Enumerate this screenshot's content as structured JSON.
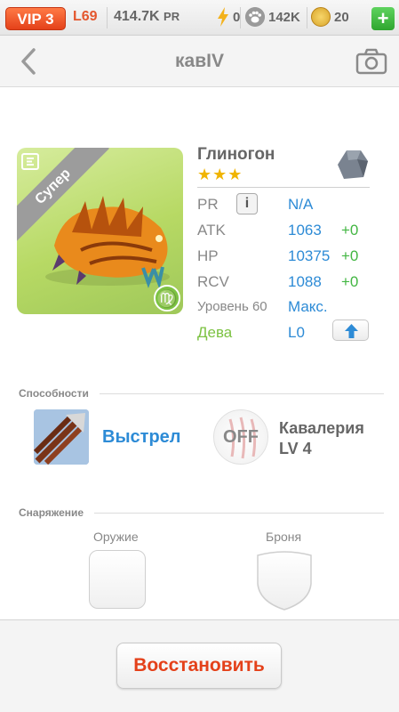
{
  "topbar": {
    "vip": "VIP 3",
    "level": "L69",
    "pr_value": "414.7K",
    "pr_unit": "PR",
    "energy": "0",
    "paws": "142K",
    "coins": "20",
    "plus": "+"
  },
  "nav": {
    "title": "кавIV"
  },
  "monster": {
    "name": "Глиногон",
    "stars": "★★★",
    "rarity_ribbon": "Супер",
    "zodiac_symbol": "♍",
    "stats": {
      "pr_label": "PR",
      "pr_info": "i",
      "pr_value": "N/A",
      "atk_label": "ATK",
      "atk_value": "1063",
      "atk_bonus": "+0",
      "hp_label": "HP",
      "hp_value": "10375",
      "hp_bonus": "+0",
      "rcv_label": "RCV",
      "rcv_value": "1088",
      "rcv_bonus": "+0",
      "level_label": "Уровень 60",
      "level_value": "Макс.",
      "zodiac_label": "Дева",
      "zodiac_level": "L0"
    }
  },
  "abilities": {
    "title": "Способности",
    "skill_name": "Выстрел",
    "leader_status": "OFF",
    "leader_name_line1": "Кавалерия",
    "leader_name_line2": "LV 4"
  },
  "equipment": {
    "title": "Снаряжение",
    "weapon_label": "Оружие",
    "armor_label": "Броня"
  },
  "bottom": {
    "restore_label": "Восстановить"
  },
  "colors": {
    "accent_orange": "#e4411a",
    "stat_blue": "#2d8bd6",
    "bonus_green": "#42b642",
    "zodiac_green": "#7cc242",
    "star_gold": "#f0b400"
  }
}
